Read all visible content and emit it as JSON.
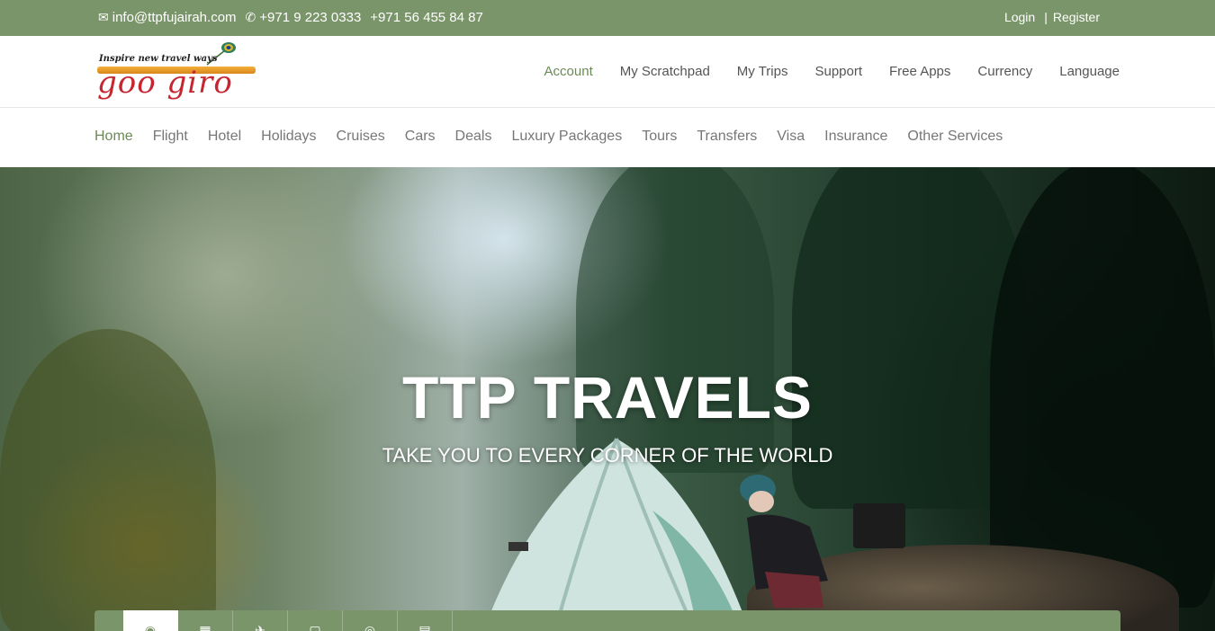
{
  "topbar": {
    "email": "info@ttpfujairah.com",
    "phone1": "+971 9 223 0333",
    "phone2": "+971 56 455 84 87",
    "login": "Login",
    "separator": "|",
    "register": "Register",
    "icons": [
      "envelope-icon",
      "phone-icon"
    ]
  },
  "logo": {
    "tagline": "Inspire new travel ways",
    "wordmark": "goo giro"
  },
  "account_nav": {
    "items": [
      "Account",
      "My Scratchpad",
      "My Trips",
      "Support",
      "Free Apps",
      "Currency",
      "Language"
    ],
    "active": "Account"
  },
  "main_nav": {
    "items": [
      "Home",
      "Flight",
      "Hotel",
      "Holidays",
      "Cruises",
      "Cars",
      "Deals",
      "Luxury Packages",
      "Tours",
      "Transfers",
      "Visa",
      "Insurance",
      "Other Services"
    ],
    "active": "Home"
  },
  "hero": {
    "title": "TTP TRAVELS",
    "subtitle": "TAKE YOU TO EVERY CORNER OF THE WORLD"
  },
  "search_tabs": {
    "icons": [
      "person-icon",
      "building-icon",
      "plane-icon",
      "bag-icon",
      "globe-icon",
      "table-icon"
    ],
    "glyphs": [
      "&#x1F464;",
      "&#x25A6;",
      "&#x2708;",
      "&#x25A2;",
      "&#x25CE;",
      "&#x25A4;"
    ]
  },
  "colors": {
    "accent": "#7a956a",
    "active_text": "#6b8a56",
    "nav_text": "#777777"
  }
}
